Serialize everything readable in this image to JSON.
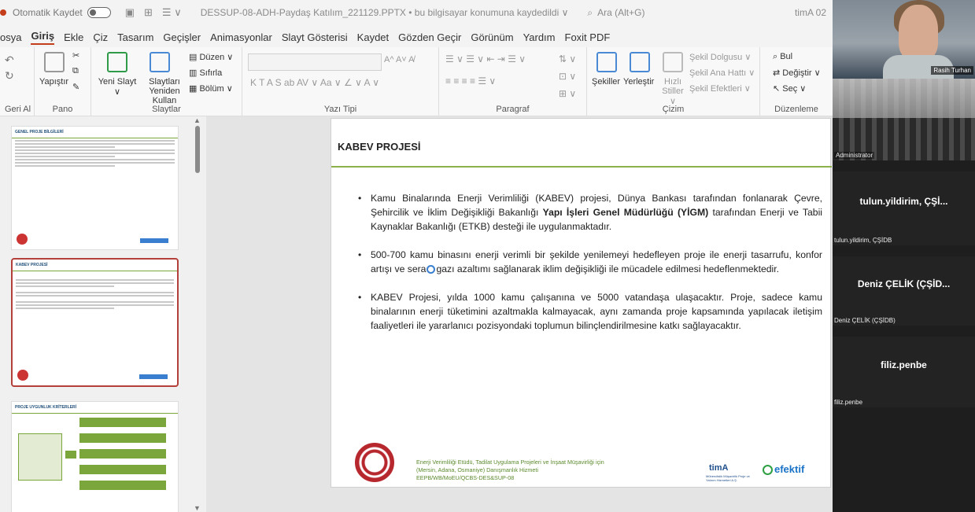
{
  "titlebar": {
    "autosave_label": "Otomatik Kaydet",
    "file_name": "DESSUP-08-ADH-Paydaş Katılım_221129.PPTX • bu bilgisayar konumuna kaydedildi ∨",
    "search_placeholder": "Ara (Alt+G)",
    "user": "timA 02"
  },
  "menu": {
    "tabs": [
      "osya",
      "Giriş",
      "Ekle",
      "Çiz",
      "Tasarım",
      "Geçişler",
      "Animasyonlar",
      "Slayt Gösterisi",
      "Kaydet",
      "Gözden Geçir",
      "Görünüm",
      "Yardım",
      "Foxit PDF"
    ],
    "active_index": 1
  },
  "ribbon": {
    "undo_group_label": "Geri Al",
    "paste_label": "Yapıştır",
    "clipboard_label": "Pano",
    "new_slide_label": "Yeni Slayt ∨",
    "reuse_slides_label": "Slaytları Yeniden Kullan",
    "layout_label": "Düzen ∨",
    "reset_label": "Sıfırla",
    "section_label": "Bölüm ∨",
    "slides_group_label": "Slaytlar",
    "font_group_label": "Yazı Tipi",
    "font_buttons": "K  T  A  S  ab  AV ∨  Aa ∨  ∠ ∨  A ∨",
    "font_size_buttons": "A^  A˅  A̸",
    "paragraph_group_label": "Paragraf",
    "shapes_label": "Şekiller",
    "arrange_label": "Yerleştir",
    "quick_styles_label": "Hızlı Stiller ∨",
    "shape_fill_label": "Şekil Dolgusu ∨",
    "shape_outline_label": "Şekil Ana Hattı ∨",
    "shape_effects_label": "Şekil Efektleri ∨",
    "drawing_group_label": "Çizim",
    "find_label": "Bul",
    "replace_label": "Değiştir ∨",
    "select_label": "Seç ∨",
    "editing_group_label": "Düzenleme"
  },
  "thumbnails": [
    {
      "title": "GENEL PROJE BİLGİLERİ"
    },
    {
      "title": "KABEV PROJESİ"
    },
    {
      "title": "PROJE UYGUNLUK KRİTERLERİ"
    }
  ],
  "slide": {
    "title": "KABEV PROJESİ",
    "bullet1_pre": "Kamu Binalarında Enerji Verimliliği (KABEV) projesi, Dünya Bankası tarafından fonlanarak Çevre, Şehircilik ve İklim Değişikliği Bakanlığı ",
    "bullet1_bold": "Yapı İşleri Genel Müdürlüğü (YİGM)",
    "bullet1_post": " tarafından Enerji ve Tabii Kaynaklar Bakanlığı (ETKB) desteği ile uygulanmaktadır.",
    "bullet2_pre": "500-700 kamu binasını enerji verimli bir şekilde yenilemeyi hedefleyen proje ile enerji tasarrufu, konfor artışı ve sera",
    "bullet2_post": "gazı azaltımı sağlanarak iklim değişikliği ile mücadele edilmesi hedeflenmektedir.",
    "bullet3": "KABEV Projesi, yılda 1000 kamu çalışanına ve 5000 vatandaşa ulaşacaktır. Proje, sadece kamu binalarının enerji tüketimini azaltmakla kalmayacak, aynı zamanda proje kapsamında yapılacak iletişim faaliyetleri ile yararlanıcı pozisyondaki toplumun bilinçlendirilmesine katkı sağlayacaktır.",
    "footer_line1": "Enerji Verimliliği Etüdü, Tadilat Uygulama Projeleri ve İnşaat Müşavirliği için",
    "footer_line2": "(Mersin, Adana, Osmaniye) Danışmanlık Hizmeti",
    "footer_line3": "EEPB/WB/MoEU/QCBS-DES&SUP-08",
    "logo_tim": "timA",
    "logo_tim_sub": "Mühendislik Müşavirlik Proje ve Yatırım Hizmetleri A.Ş.",
    "logo_efektif": "efektif"
  },
  "gallery": {
    "speaker_name": "Rasih Turhan",
    "tile2_caption": "Administrator",
    "tile3_name": "tulun.yildirim, ÇŞİ...",
    "tile3_caption": "tulun.yildirim, ÇŞİDB",
    "tile4_name": "Deniz ÇELİK (ÇŞİD...",
    "tile4_caption": "Deniz ÇELİK (ÇŞİDB)",
    "tile5_name": "filiz.penbe",
    "tile5_caption": "filiz.penbe"
  },
  "colors": {
    "accent": "#c43e1c",
    "slide_rule": "#8cb04a",
    "thumb_selected": "#b3403a"
  }
}
